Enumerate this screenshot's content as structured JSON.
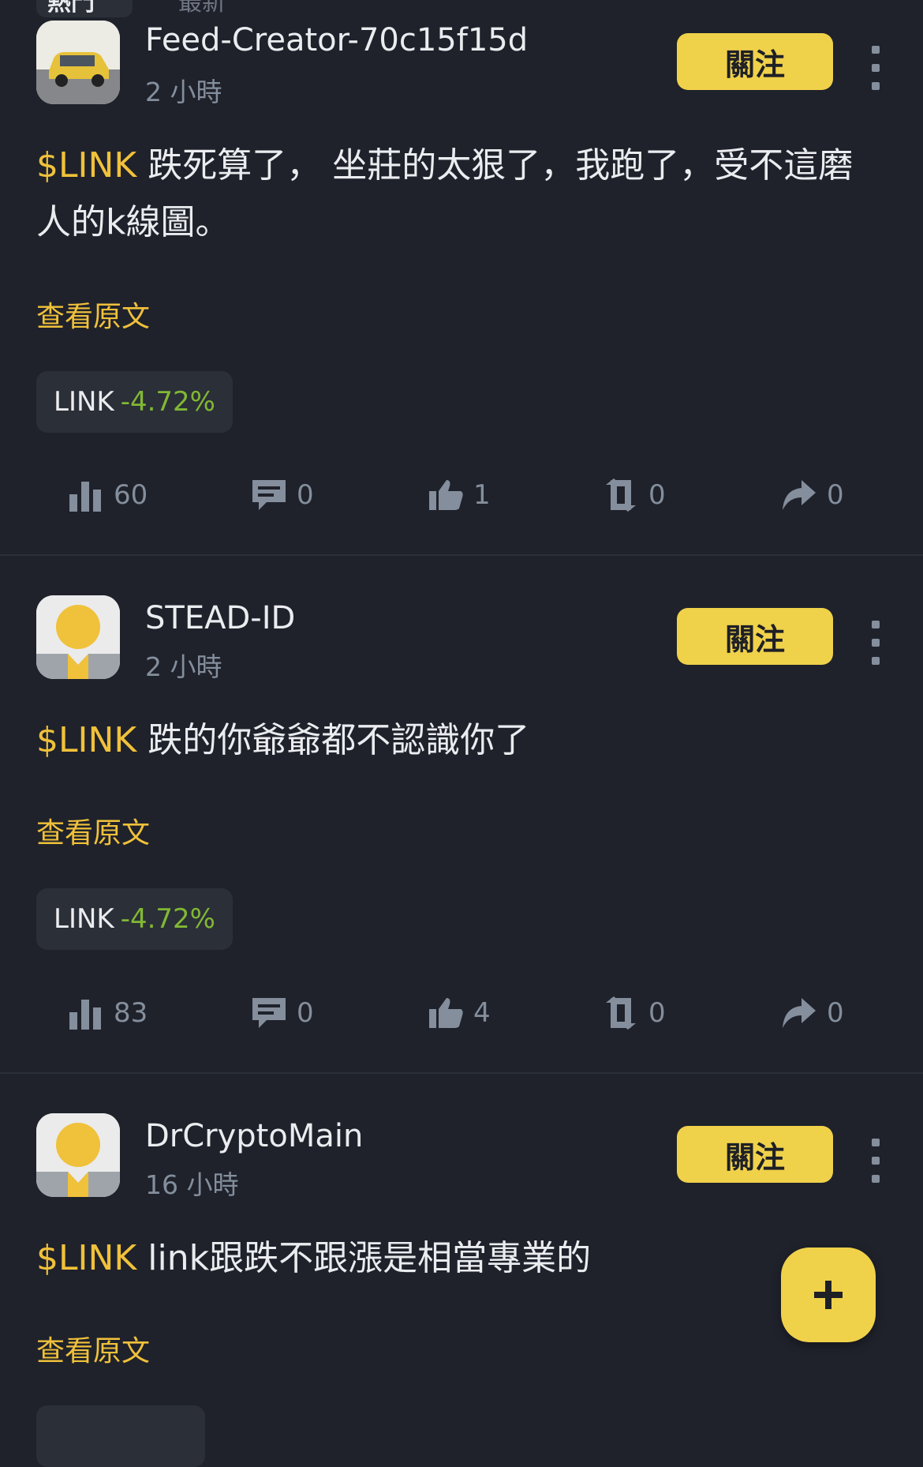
{
  "tabs": {
    "active": "熱門",
    "other": "最新"
  },
  "posts": [
    {
      "username": "Feed-Creator-70c15f15d",
      "time": "2 小時",
      "follow_label": "關注",
      "ticker": "$LINK",
      "text": " 跌死算了， 坐莊的太狠了，我跑了，受不這磨人的k線圖。",
      "view_original": "查看原文",
      "coin": {
        "symbol": "LINK",
        "change": "-4.72%"
      },
      "stats": {
        "views": "60",
        "comments": "0",
        "likes": "1",
        "reposts": "0",
        "shares": "0"
      }
    },
    {
      "username": "STEAD-ID",
      "time": "2 小時",
      "follow_label": "關注",
      "ticker": "$LINK",
      "text": " 跌的你爺爺都不認識你了",
      "view_original": "查看原文",
      "coin": {
        "symbol": "LINK",
        "change": "-4.72%"
      },
      "stats": {
        "views": "83",
        "comments": "0",
        "likes": "4",
        "reposts": "0",
        "shares": "0"
      }
    },
    {
      "username": "DrCryptoMain",
      "time": "16 小時",
      "follow_label": "關注",
      "ticker": "$LINK",
      "text": " link跟跌不跟漲是相當專業的",
      "view_original": "查看原文"
    }
  ],
  "colors": {
    "background": "#1f222b",
    "accent": "#f0d14a",
    "ticker": "#f0c13a",
    "negative_change": "#80b834",
    "muted": "#848e9c"
  },
  "icons": [
    "views-icon",
    "comment-icon",
    "like-icon",
    "repost-icon",
    "share-icon",
    "more-icon",
    "plus-icon"
  ]
}
